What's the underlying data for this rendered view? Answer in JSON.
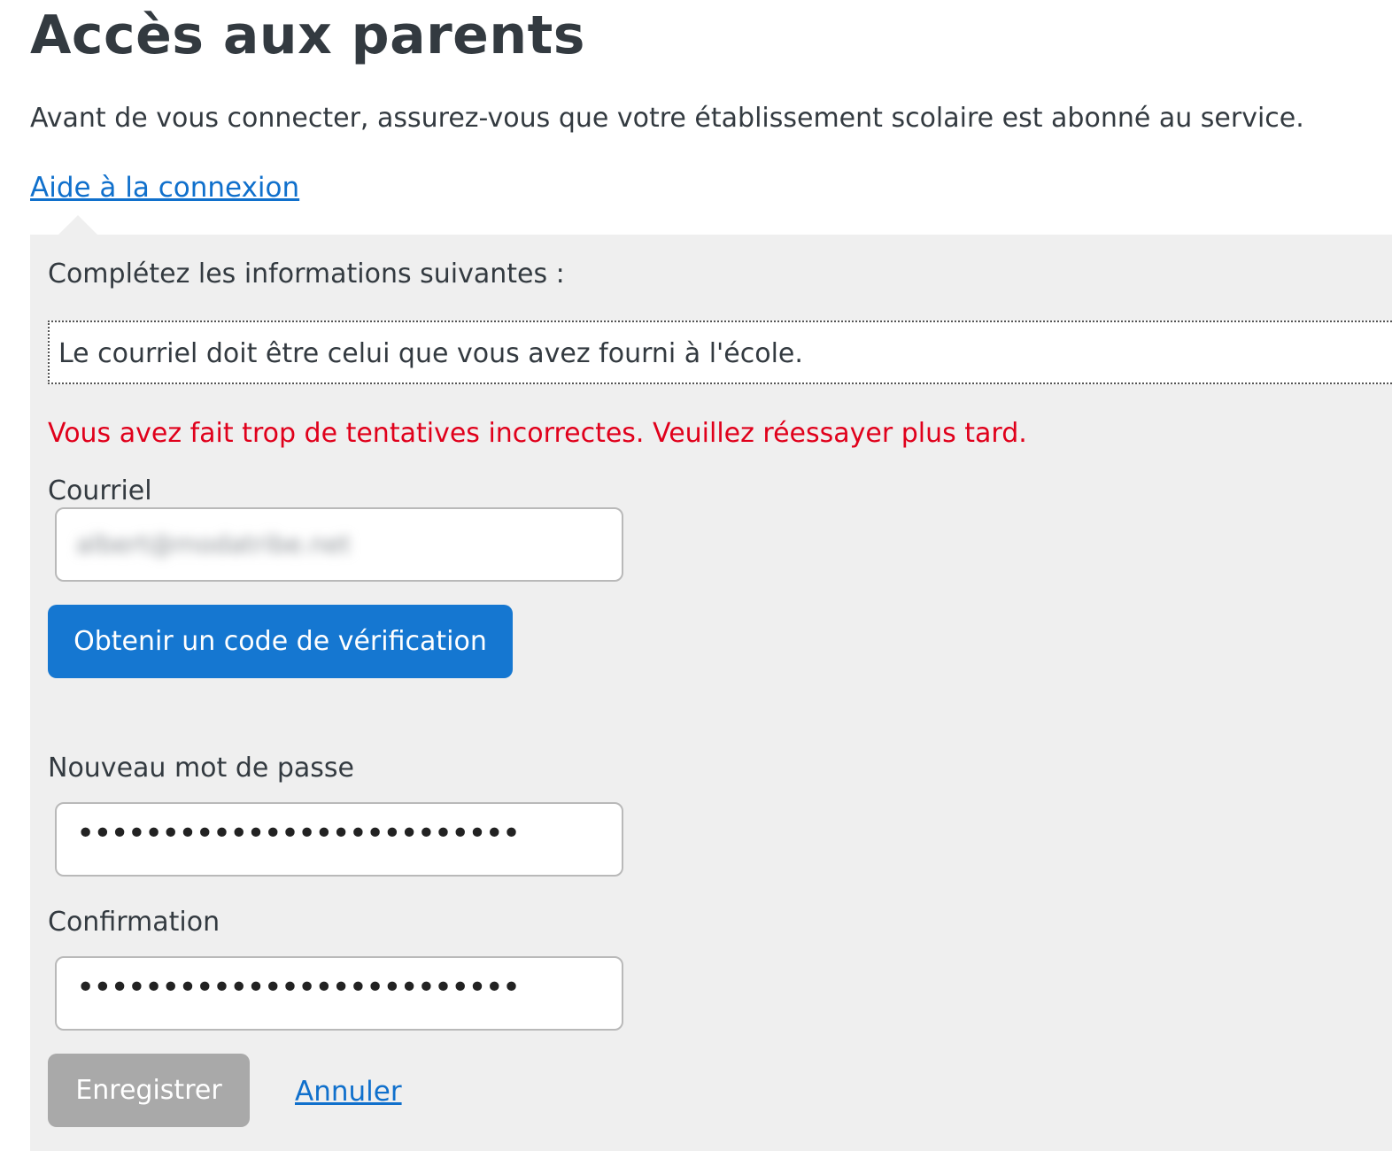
{
  "page": {
    "title": "Accès aux parents",
    "intro": "Avant de vous connecter, assurez-vous que votre établissement scolaire est abonné au service.",
    "help_link": "Aide à la connexion"
  },
  "form": {
    "heading": "Complétez les informations suivantes :",
    "notice": "Le courriel doit être celui que vous avez fourni à l'école.",
    "error": "Vous avez fait trop de tentatives incorrectes. Veuillez réessayer plus tard.",
    "email": {
      "label": "Courriel",
      "value": "albert@modatribe.net"
    },
    "verify_button": "Obtenir un code de vérification",
    "new_password": {
      "label": "Nouveau mot de passe",
      "value": "••••••••••••••••••••••••••"
    },
    "confirmation": {
      "label": "Confirmation",
      "value": "••••••••••••••••••••••••••"
    },
    "save_button": "Enregistrer",
    "cancel_link": "Annuler"
  },
  "colors": {
    "primary": "#1577d1",
    "link": "#1070cc",
    "error": "#e0001b",
    "panel_bg": "#efefef",
    "disabled": "#a9a9a9"
  }
}
